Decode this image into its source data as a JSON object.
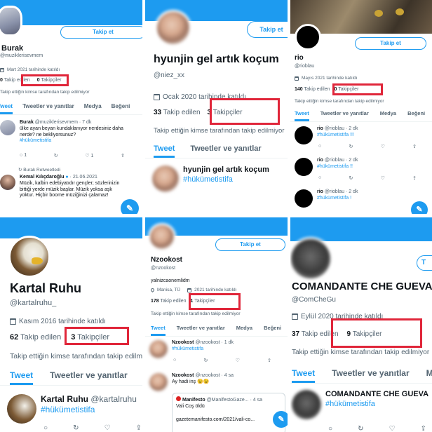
{
  "common": {
    "follow_label": "Takip et",
    "following_label": "Takip edilen",
    "followers_label": "Takipçiler",
    "no_follow_note": "Takip ettiğin kimse tarafından takip edilmiyor",
    "tab_tweets": "Tweet",
    "tab_replies": "Tweetler ve yanıtlar",
    "tab_media": "Medya",
    "tab_likes": "Beğeni",
    "hashtag": "#hükümetistifa",
    "retweet_icon": "↻",
    "fab_icon": "✎"
  },
  "p1": {
    "name": "Burak",
    "handle": "@muziklerisevmem",
    "joined": "Mart 2021 tarihinde katıldı",
    "following": "0",
    "followers": "0",
    "tweet1_name": "Burak",
    "tweet1_meta": "@muziklerisevmem · 7 dk",
    "tweet1_text": "ülke ayan beyan kundaklanıyor nerdesiniz daha nerde? ne bekliyorsunuz?",
    "tweet1_tag": "#hükümetistifa",
    "tweet1_reply": "1",
    "tweet1_like": "1",
    "retweeted_by": "Burak Retweetledi",
    "tweet2_name": "Kemal Kılıçdaroğlu",
    "tweet2_meta": "· 21.06.2021",
    "tweet2_text": "Müzik, kalbin edebiyatıdır gençler; sözlerinizin bittiği yerde müzik başlar. Müzik yoksa aşk yoktur. Hiçbir boome müziğinizi çalamaz!"
  },
  "p2": {
    "name": "hyunjin gel artık koçum",
    "handle": "@niez_xx",
    "joined": "Ocak 2020 tarihinde katıldı",
    "following": "33",
    "followers": "3",
    "tweet_name": "hyunjin gel artık koçum"
  },
  "p3": {
    "name": "rio",
    "handle": "@rioblau",
    "joined": "Mayıs 2021 tarihinde katıldı",
    "following": "140",
    "followers": "0",
    "t1_meta": "@rioblau · 2 dk",
    "t1_tag": "#hükümetistifa !!!",
    "t2_meta": "@rioblau · 2 dk",
    "t2_tag": "#hükümetistifa !!",
    "t3_meta": "@rioblau · 2 dk",
    "t3_tag": "#hükümetistifa !"
  },
  "p4": {
    "name": "Kartal Ruhu",
    "handle": "@kartalruhu_",
    "joined": "Kasım 2016 tarihinde katıldı",
    "following": "62",
    "followers": "3",
    "tweet_name": "Kartal Ruhu",
    "tweet_handle": "@kartalruhu"
  },
  "p5": {
    "name": "Nzookost",
    "handle": "@nzookost",
    "bio": "yalnizcaonemlidm",
    "location": "Manisa, TÜ",
    "joined": "2021 tarihinde katıldı",
    "following": "178",
    "followers": "1",
    "t1_name": "Nzookost",
    "t1_meta": "@nzookost · 1 dk",
    "t2_name": "Nzookost",
    "t2_meta": "@nzookost · 4 sa",
    "t2_text": "Ay hadi inş 😉😉",
    "quote_name": "Manifesto",
    "quote_meta": "@ManifestoGaze...",
    "quote_age": "· 4 sa",
    "quote_text": "Vali Coş öldü",
    "quote_link": "gazetemanifesto.com/2021/vali-co..."
  },
  "p6": {
    "name": "COMANDANTE CHE GUEVA",
    "handle": "@ComCheGu",
    "joined": "Eylül 2020 tarihinde katıldı",
    "following": "37",
    "followers": "9",
    "tweet_name": "COMANDANTE CHE GUEVA",
    "follow_partial": "T"
  }
}
